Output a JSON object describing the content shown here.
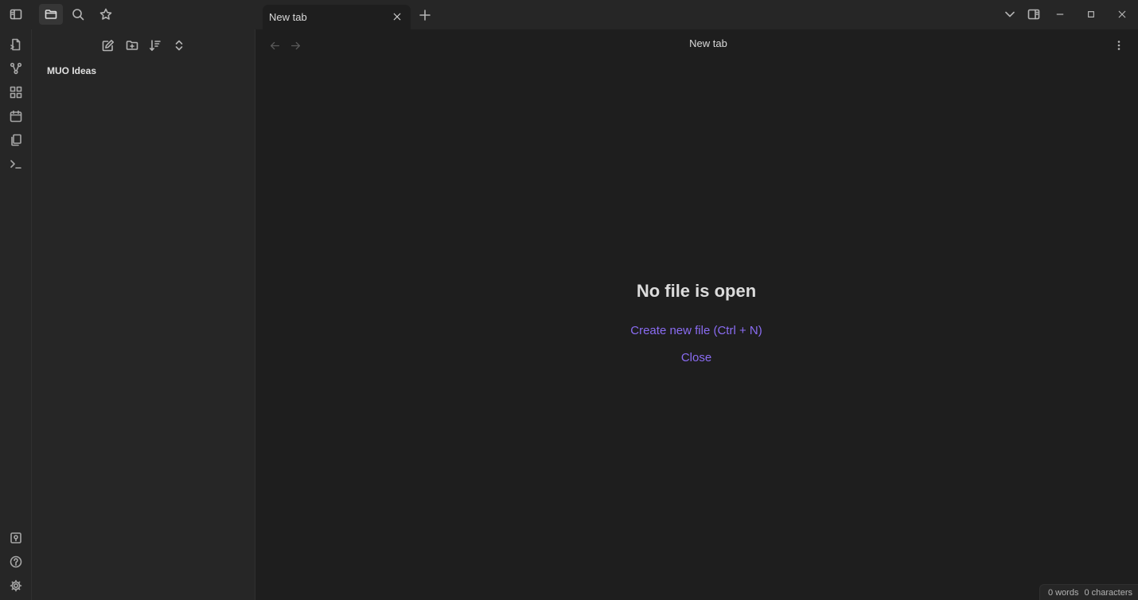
{
  "titlebar": {
    "tab": {
      "title": "New tab"
    }
  },
  "sidebar": {
    "vault_name": "MUO Ideas"
  },
  "main": {
    "view_title": "New tab",
    "empty_state": {
      "title": "No file is open",
      "create_label": "Create new file (Ctrl + N)",
      "close_label": "Close"
    }
  },
  "status_bar": {
    "words": "0 words",
    "characters": "0 characters"
  },
  "icons": {
    "titlebar": [
      "sidebar-toggle-icon",
      "folder-icon",
      "search-icon",
      "star-icon",
      "close-icon",
      "plus-icon",
      "chevron-down-icon",
      "right-sidebar-icon",
      "minimize-icon",
      "maximize-icon",
      "window-close-icon"
    ],
    "ribbon": [
      "open-quick-switcher-icon",
      "graph-view-icon",
      "canvas-icon",
      "calendar-icon",
      "templates-icon",
      "command-palette-icon",
      "vault-switcher-icon",
      "help-icon",
      "settings-icon"
    ],
    "explorer_toolbar": [
      "new-note-icon",
      "new-folder-icon",
      "sort-icon",
      "collapse-expand-icon"
    ]
  },
  "colors": {
    "accent": "#8a6cf2",
    "background": "#1e1e1e",
    "panel": "#262626"
  }
}
